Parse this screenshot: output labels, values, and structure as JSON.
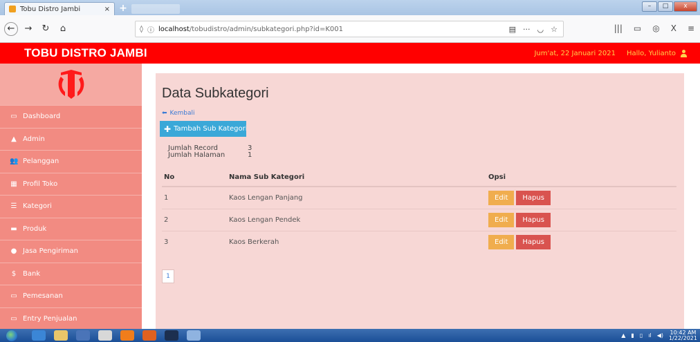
{
  "browser": {
    "tab_title": "Tobu Distro Jambi",
    "tab_close": "×",
    "new_tab": "+",
    "url_prefix": "localhost",
    "url_path": "/tobudistro/admin/subkategori.php?id=K001",
    "minimize": "–",
    "maximize": "□",
    "close": "x"
  },
  "header": {
    "brand": "TOBU DISTRO JAMBI",
    "date": "Jum'at, 22 Januari 2021",
    "greeting": "Hallo, Yulianto"
  },
  "sidebar": {
    "items": [
      {
        "label": "Dashboard",
        "icon": "monitor-icon",
        "glyph": "▭"
      },
      {
        "label": "Admin",
        "icon": "user-icon",
        "glyph": "▲"
      },
      {
        "label": "Pelanggan",
        "icon": "users-icon",
        "glyph": "👥"
      },
      {
        "label": "Profil Toko",
        "icon": "grid-icon",
        "glyph": "▦"
      },
      {
        "label": "Kategori",
        "icon": "list-icon",
        "glyph": "☰"
      },
      {
        "label": "Produk",
        "icon": "car-icon",
        "glyph": "▬"
      },
      {
        "label": "Jasa Pengiriman",
        "icon": "map-marker-icon",
        "glyph": "●"
      },
      {
        "label": "Bank",
        "icon": "dollar-icon",
        "glyph": "$"
      },
      {
        "label": "Pemesanan",
        "icon": "credit-card-icon",
        "glyph": "▭"
      },
      {
        "label": "Entry Penjualan",
        "icon": "credit-card-icon",
        "glyph": "▭"
      }
    ]
  },
  "main": {
    "title": "Data Subkategori",
    "back_label": "Kembali",
    "add_label": "Tambah Sub Kategori",
    "info": [
      {
        "label": "Jumlah Record",
        "value": "3"
      },
      {
        "label": "Jumlah Halaman",
        "value": "1"
      }
    ],
    "table": {
      "headers": [
        "No",
        "Nama Sub Kategori",
        "Opsi"
      ],
      "rows": [
        {
          "no": "1",
          "name": "Kaos Lengan Panjang"
        },
        {
          "no": "2",
          "name": "Kaos Lengan Pendek"
        },
        {
          "no": "3",
          "name": "Kaos Berkerah"
        }
      ],
      "edit_label": "Edit",
      "delete_label": "Hapus"
    },
    "pagination": [
      "1"
    ]
  },
  "taskbar": {
    "time": "10:42 AM",
    "date": "1/22/2021"
  },
  "colors": {
    "header": "#ff0000",
    "sidebar": "#f28b82",
    "panel": "#f7d7d5",
    "add_button": "#3aa8d8",
    "edit_button": "#f0ad4e",
    "delete_button": "#d9534f"
  }
}
